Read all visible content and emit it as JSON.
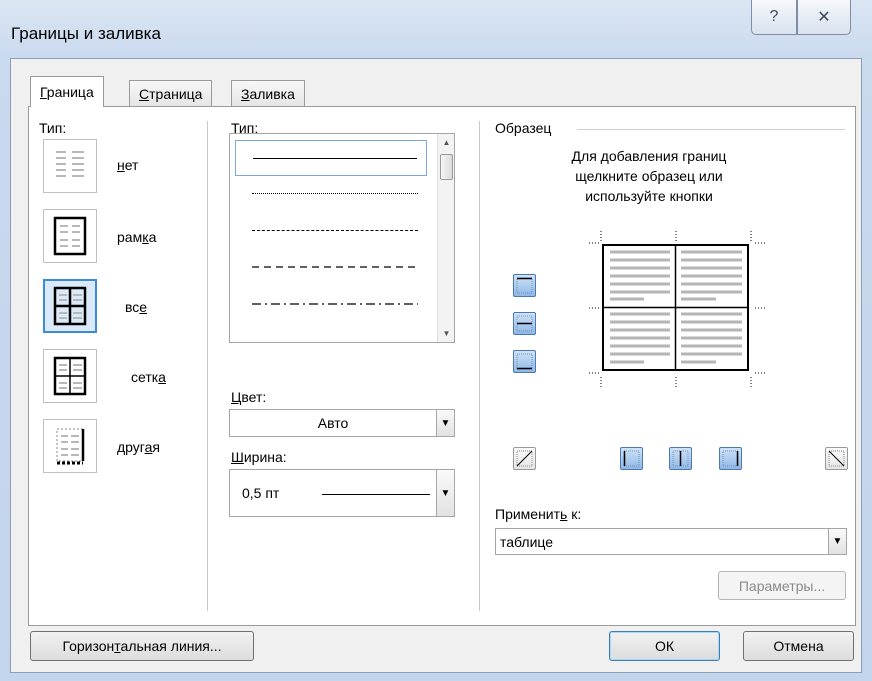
{
  "window": {
    "title": "Границы и заливка",
    "help_glyph": "?",
    "close_glyph": "✕"
  },
  "tabs": [
    {
      "pre": "",
      "acc": "Г",
      "post": "раница",
      "active": true
    },
    {
      "pre": "",
      "acc": "С",
      "post": "траница",
      "active": false
    },
    {
      "pre": "",
      "acc": "З",
      "post": "аливка",
      "active": false
    }
  ],
  "setting": {
    "label": "Тип:",
    "presets": [
      {
        "pre": "",
        "acc": "н",
        "post": "ет"
      },
      {
        "pre": "рам",
        "acc": "к",
        "post": "а"
      },
      {
        "pre": "вс",
        "acc": "е",
        "post": ""
      },
      {
        "pre": "сетк",
        "acc": "а",
        "post": ""
      },
      {
        "pre": "друг",
        "acc": "а",
        "post": "я"
      }
    ]
  },
  "style": {
    "label_pre": "Ти",
    "label_acc": "п",
    "label_post": ":",
    "styles": [
      "solid",
      "dotted",
      "dashed-small",
      "dashed",
      "dash-dot"
    ]
  },
  "color": {
    "label_acc": "Ц",
    "label_post": "вет:",
    "value": "Авто"
  },
  "width": {
    "label_acc": "Ш",
    "label_post": "ирина:",
    "value": "0,5 пт"
  },
  "preview": {
    "label": "Образец",
    "hint": [
      "Для добавления границ",
      "щелкните образец или",
      "используйте кнопки"
    ]
  },
  "apply_to": {
    "label_pre": "Применит",
    "label_acc": "ь",
    "label_post": " к:",
    "value": "таблице"
  },
  "buttons": {
    "options": "Параметры...",
    "hline_pre": "Горизон",
    "hline_acc": "т",
    "hline_post": "альная линия...",
    "ok": "ОК",
    "cancel": "Отмена"
  },
  "colors": {
    "selection_blue": "#3f8ad6",
    "title_bg": "#c9d9ee",
    "border_button_blue": "#8fb7e6"
  }
}
